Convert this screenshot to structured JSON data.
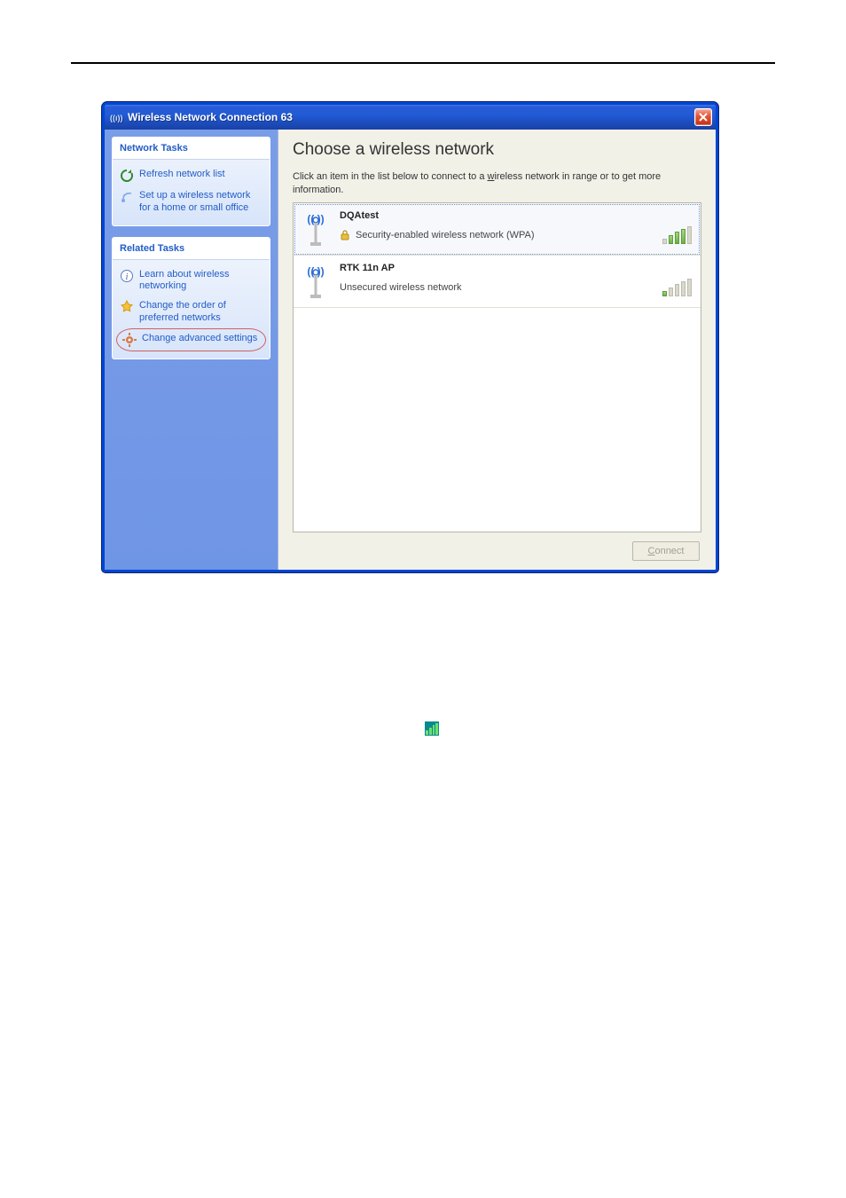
{
  "window": {
    "title": "Wireless Network Connection 63"
  },
  "sidebar": {
    "group1": {
      "header": "Network Tasks",
      "items": [
        {
          "label": "Refresh network list"
        },
        {
          "label": "Set up a wireless network for a home or small office"
        }
      ]
    },
    "group2": {
      "header": "Related Tasks",
      "items": [
        {
          "label": "Learn about wireless networking"
        },
        {
          "label": "Change the order of preferred networks"
        },
        {
          "label": "Change advanced settings"
        }
      ]
    }
  },
  "main": {
    "heading": "Choose a wireless network",
    "instruction_pre": "Click an item in the list below to connect to a ",
    "instruction_underline": "w",
    "instruction_post": "ireless network in range or to get more information.",
    "networks": [
      {
        "name": "DQAtest",
        "sub": "Security-enabled wireless network (WPA)",
        "secured": true,
        "signal": 3
      },
      {
        "name": "RTK 11n AP",
        "sub": "Unsecured wireless network",
        "secured": false,
        "signal": 1
      }
    ],
    "connect_label": "onnect",
    "connect_accel": "C"
  }
}
